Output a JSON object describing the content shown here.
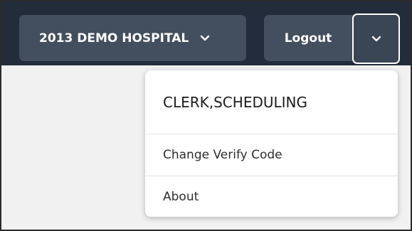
{
  "header": {
    "hospital_label": "2013 DEMO HOSPITAL",
    "logout_label": "Logout"
  },
  "user_menu": {
    "user_name": "CLERK,SCHEDULING",
    "items": [
      {
        "label": "Change Verify Code"
      },
      {
        "label": "About"
      }
    ]
  },
  "icons": {
    "hospital_dropdown": "chevron-down-icon",
    "user_menu_toggle": "chevron-down-icon"
  },
  "colors": {
    "topbar": "#222c3a",
    "button": "#434e5e",
    "menu_background": "#ffffff"
  }
}
